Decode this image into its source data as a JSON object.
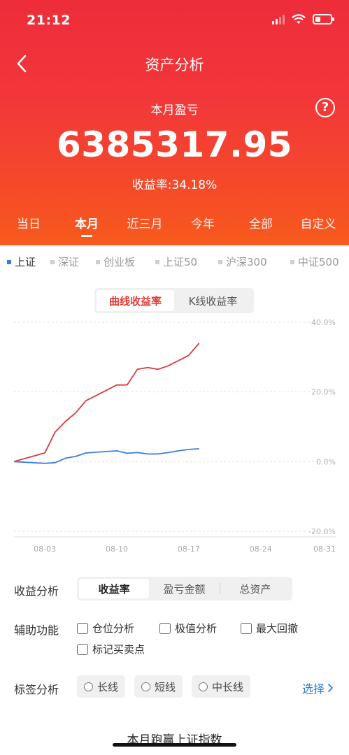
{
  "status_bar": {
    "time": "21:12"
  },
  "nav": {
    "title": "资产分析"
  },
  "summary": {
    "label": "本月盈亏",
    "amount": "6385317.95",
    "rate_text": "收益率:34.18%"
  },
  "period_tabs": [
    {
      "label": "当日"
    },
    {
      "label": "本月",
      "active": true
    },
    {
      "label": "近三月"
    },
    {
      "label": "今年"
    },
    {
      "label": "全部"
    },
    {
      "label": "自定义"
    }
  ],
  "index_tabs": [
    {
      "label": "上证",
      "active": true
    },
    {
      "label": "深证"
    },
    {
      "label": "创业板"
    },
    {
      "label": "上证50"
    },
    {
      "label": "沪深300"
    },
    {
      "label": "中证500"
    }
  ],
  "chart_toggle": [
    {
      "label": "曲线收益率",
      "active": true
    },
    {
      "label": "K线收益率"
    }
  ],
  "chart_data": {
    "type": "line",
    "x_ticks": [
      "08-03",
      "08-10",
      "08-17",
      "08-24",
      "08-31"
    ],
    "y_ticks": [
      "40.0%",
      "20.0%",
      "0.0%",
      "-20.0%"
    ],
    "ylim": [
      -20,
      40
    ],
    "series": [
      {
        "color": "#d93b3b",
        "points": [
          [
            0,
            0.0
          ],
          [
            3,
            2.5
          ],
          [
            4,
            8.5
          ],
          [
            5,
            11.5
          ],
          [
            6,
            14.0
          ],
          [
            7,
            17.5
          ],
          [
            8,
            19.0
          ],
          [
            9,
            20.5
          ],
          [
            10,
            22.0
          ],
          [
            11,
            22.0
          ],
          [
            12,
            26.5
          ],
          [
            13,
            27.0
          ],
          [
            14,
            26.5
          ],
          [
            15,
            27.5
          ],
          [
            16,
            29.0
          ],
          [
            17,
            30.5
          ],
          [
            18,
            34.0
          ]
        ]
      },
      {
        "color": "#3b7ddd",
        "points": [
          [
            0,
            0.0
          ],
          [
            3,
            -0.5
          ],
          [
            4,
            -0.3
          ],
          [
            5,
            1.0
          ],
          [
            6,
            1.5
          ],
          [
            7,
            2.5
          ],
          [
            8,
            2.7
          ],
          [
            9,
            2.9
          ],
          [
            10,
            3.1
          ],
          [
            11,
            2.4
          ],
          [
            12,
            2.6
          ],
          [
            13,
            2.2
          ],
          [
            14,
            2.2
          ],
          [
            15,
            2.6
          ],
          [
            16,
            3.1
          ],
          [
            17,
            3.5
          ],
          [
            18,
            3.7
          ]
        ]
      }
    ],
    "grid": true
  },
  "analysis": {
    "label": "收益分析",
    "options": [
      {
        "label": "收益率",
        "active": true
      },
      {
        "label": "盈亏金额"
      },
      {
        "label": "总资产"
      }
    ]
  },
  "aux": {
    "label": "辅助功能",
    "options": [
      "仓位分析",
      "极值分析",
      "最大回撤",
      "标记买卖点"
    ]
  },
  "tags": {
    "label": "标签分析",
    "options": [
      "长线",
      "短线",
      "中长线"
    ],
    "select_label": "选择"
  },
  "bottom_text": "本月跑赢上证指数"
}
